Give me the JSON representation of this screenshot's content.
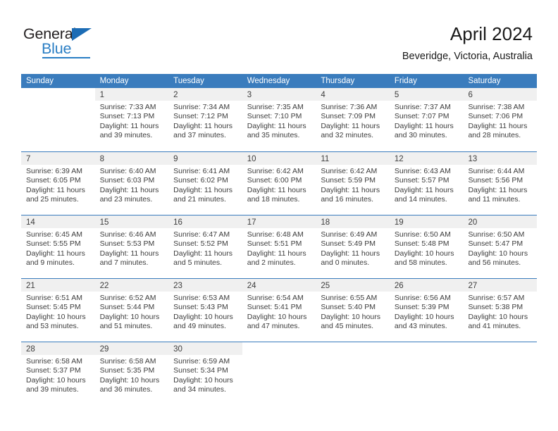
{
  "logo": {
    "word_one": "General",
    "word_two": "Blue",
    "flag_icon": "triangle-flag-icon"
  },
  "header": {
    "title": "April 2024",
    "subtitle": "Beveridge, Victoria, Australia"
  },
  "weekdays": [
    "Sunday",
    "Monday",
    "Tuesday",
    "Wednesday",
    "Thursday",
    "Friday",
    "Saturday"
  ],
  "colors": {
    "header_blue": "#3a7cbd",
    "logo_blue": "#2a7ec4",
    "day_band_gray": "#f0f0f0",
    "text": "#3d3d3d"
  },
  "weeks": [
    [
      {
        "blank": true,
        "num": "",
        "sunrise": "",
        "sunset": "",
        "daylight_1": "",
        "daylight_2": ""
      },
      {
        "blank": false,
        "num": "1",
        "sunrise": "Sunrise: 7:33 AM",
        "sunset": "Sunset: 7:13 PM",
        "daylight_1": "Daylight: 11 hours",
        "daylight_2": "and 39 minutes."
      },
      {
        "blank": false,
        "num": "2",
        "sunrise": "Sunrise: 7:34 AM",
        "sunset": "Sunset: 7:12 PM",
        "daylight_1": "Daylight: 11 hours",
        "daylight_2": "and 37 minutes."
      },
      {
        "blank": false,
        "num": "3",
        "sunrise": "Sunrise: 7:35 AM",
        "sunset": "Sunset: 7:10 PM",
        "daylight_1": "Daylight: 11 hours",
        "daylight_2": "and 35 minutes."
      },
      {
        "blank": false,
        "num": "4",
        "sunrise": "Sunrise: 7:36 AM",
        "sunset": "Sunset: 7:09 PM",
        "daylight_1": "Daylight: 11 hours",
        "daylight_2": "and 32 minutes."
      },
      {
        "blank": false,
        "num": "5",
        "sunrise": "Sunrise: 7:37 AM",
        "sunset": "Sunset: 7:07 PM",
        "daylight_1": "Daylight: 11 hours",
        "daylight_2": "and 30 minutes."
      },
      {
        "blank": false,
        "num": "6",
        "sunrise": "Sunrise: 7:38 AM",
        "sunset": "Sunset: 7:06 PM",
        "daylight_1": "Daylight: 11 hours",
        "daylight_2": "and 28 minutes."
      }
    ],
    [
      {
        "blank": false,
        "num": "7",
        "sunrise": "Sunrise: 6:39 AM",
        "sunset": "Sunset: 6:05 PM",
        "daylight_1": "Daylight: 11 hours",
        "daylight_2": "and 25 minutes."
      },
      {
        "blank": false,
        "num": "8",
        "sunrise": "Sunrise: 6:40 AM",
        "sunset": "Sunset: 6:03 PM",
        "daylight_1": "Daylight: 11 hours",
        "daylight_2": "and 23 minutes."
      },
      {
        "blank": false,
        "num": "9",
        "sunrise": "Sunrise: 6:41 AM",
        "sunset": "Sunset: 6:02 PM",
        "daylight_1": "Daylight: 11 hours",
        "daylight_2": "and 21 minutes."
      },
      {
        "blank": false,
        "num": "10",
        "sunrise": "Sunrise: 6:42 AM",
        "sunset": "Sunset: 6:00 PM",
        "daylight_1": "Daylight: 11 hours",
        "daylight_2": "and 18 minutes."
      },
      {
        "blank": false,
        "num": "11",
        "sunrise": "Sunrise: 6:42 AM",
        "sunset": "Sunset: 5:59 PM",
        "daylight_1": "Daylight: 11 hours",
        "daylight_2": "and 16 minutes."
      },
      {
        "blank": false,
        "num": "12",
        "sunrise": "Sunrise: 6:43 AM",
        "sunset": "Sunset: 5:57 PM",
        "daylight_1": "Daylight: 11 hours",
        "daylight_2": "and 14 minutes."
      },
      {
        "blank": false,
        "num": "13",
        "sunrise": "Sunrise: 6:44 AM",
        "sunset": "Sunset: 5:56 PM",
        "daylight_1": "Daylight: 11 hours",
        "daylight_2": "and 11 minutes."
      }
    ],
    [
      {
        "blank": false,
        "num": "14",
        "sunrise": "Sunrise: 6:45 AM",
        "sunset": "Sunset: 5:55 PM",
        "daylight_1": "Daylight: 11 hours",
        "daylight_2": "and 9 minutes."
      },
      {
        "blank": false,
        "num": "15",
        "sunrise": "Sunrise: 6:46 AM",
        "sunset": "Sunset: 5:53 PM",
        "daylight_1": "Daylight: 11 hours",
        "daylight_2": "and 7 minutes."
      },
      {
        "blank": false,
        "num": "16",
        "sunrise": "Sunrise: 6:47 AM",
        "sunset": "Sunset: 5:52 PM",
        "daylight_1": "Daylight: 11 hours",
        "daylight_2": "and 5 minutes."
      },
      {
        "blank": false,
        "num": "17",
        "sunrise": "Sunrise: 6:48 AM",
        "sunset": "Sunset: 5:51 PM",
        "daylight_1": "Daylight: 11 hours",
        "daylight_2": "and 2 minutes."
      },
      {
        "blank": false,
        "num": "18",
        "sunrise": "Sunrise: 6:49 AM",
        "sunset": "Sunset: 5:49 PM",
        "daylight_1": "Daylight: 11 hours",
        "daylight_2": "and 0 minutes."
      },
      {
        "blank": false,
        "num": "19",
        "sunrise": "Sunrise: 6:50 AM",
        "sunset": "Sunset: 5:48 PM",
        "daylight_1": "Daylight: 10 hours",
        "daylight_2": "and 58 minutes."
      },
      {
        "blank": false,
        "num": "20",
        "sunrise": "Sunrise: 6:50 AM",
        "sunset": "Sunset: 5:47 PM",
        "daylight_1": "Daylight: 10 hours",
        "daylight_2": "and 56 minutes."
      }
    ],
    [
      {
        "blank": false,
        "num": "21",
        "sunrise": "Sunrise: 6:51 AM",
        "sunset": "Sunset: 5:45 PM",
        "daylight_1": "Daylight: 10 hours",
        "daylight_2": "and 53 minutes."
      },
      {
        "blank": false,
        "num": "22",
        "sunrise": "Sunrise: 6:52 AM",
        "sunset": "Sunset: 5:44 PM",
        "daylight_1": "Daylight: 10 hours",
        "daylight_2": "and 51 minutes."
      },
      {
        "blank": false,
        "num": "23",
        "sunrise": "Sunrise: 6:53 AM",
        "sunset": "Sunset: 5:43 PM",
        "daylight_1": "Daylight: 10 hours",
        "daylight_2": "and 49 minutes."
      },
      {
        "blank": false,
        "num": "24",
        "sunrise": "Sunrise: 6:54 AM",
        "sunset": "Sunset: 5:41 PM",
        "daylight_1": "Daylight: 10 hours",
        "daylight_2": "and 47 minutes."
      },
      {
        "blank": false,
        "num": "25",
        "sunrise": "Sunrise: 6:55 AM",
        "sunset": "Sunset: 5:40 PM",
        "daylight_1": "Daylight: 10 hours",
        "daylight_2": "and 45 minutes."
      },
      {
        "blank": false,
        "num": "26",
        "sunrise": "Sunrise: 6:56 AM",
        "sunset": "Sunset: 5:39 PM",
        "daylight_1": "Daylight: 10 hours",
        "daylight_2": "and 43 minutes."
      },
      {
        "blank": false,
        "num": "27",
        "sunrise": "Sunrise: 6:57 AM",
        "sunset": "Sunset: 5:38 PM",
        "daylight_1": "Daylight: 10 hours",
        "daylight_2": "and 41 minutes."
      }
    ],
    [
      {
        "blank": false,
        "num": "28",
        "sunrise": "Sunrise: 6:58 AM",
        "sunset": "Sunset: 5:37 PM",
        "daylight_1": "Daylight: 10 hours",
        "daylight_2": "and 39 minutes."
      },
      {
        "blank": false,
        "num": "29",
        "sunrise": "Sunrise: 6:58 AM",
        "sunset": "Sunset: 5:35 PM",
        "daylight_1": "Daylight: 10 hours",
        "daylight_2": "and 36 minutes."
      },
      {
        "blank": false,
        "num": "30",
        "sunrise": "Sunrise: 6:59 AM",
        "sunset": "Sunset: 5:34 PM",
        "daylight_1": "Daylight: 10 hours",
        "daylight_2": "and 34 minutes."
      },
      {
        "blank": true,
        "num": "",
        "sunrise": "",
        "sunset": "",
        "daylight_1": "",
        "daylight_2": ""
      },
      {
        "blank": true,
        "num": "",
        "sunrise": "",
        "sunset": "",
        "daylight_1": "",
        "daylight_2": ""
      },
      {
        "blank": true,
        "num": "",
        "sunrise": "",
        "sunset": "",
        "daylight_1": "",
        "daylight_2": ""
      },
      {
        "blank": true,
        "num": "",
        "sunrise": "",
        "sunset": "",
        "daylight_1": "",
        "daylight_2": ""
      }
    ]
  ]
}
